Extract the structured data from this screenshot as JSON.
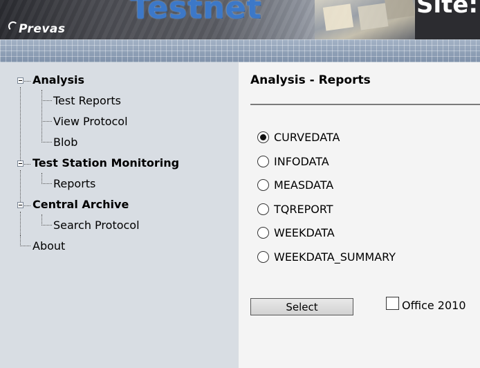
{
  "header": {
    "brand": "Prevas",
    "app_title": "Testnet",
    "site_label": "Site:"
  },
  "sidebar": {
    "groups": [
      {
        "label": "Analysis",
        "children": [
          "Test Reports",
          "View Protocol",
          "Blob"
        ]
      },
      {
        "label": "Test Station Monitoring",
        "children": [
          "Reports"
        ]
      },
      {
        "label": "Central Archive",
        "children": [
          "Search Protocol"
        ]
      }
    ],
    "about": "About"
  },
  "main": {
    "title": "Analysis - Reports",
    "options": [
      {
        "label": "CURVEDATA",
        "checked": true
      },
      {
        "label": "INFODATA",
        "checked": false
      },
      {
        "label": "MEASDATA",
        "checked": false
      },
      {
        "label": "TQREPORT",
        "checked": false
      },
      {
        "label": "WEEKDATA",
        "checked": false
      },
      {
        "label": "WEEKDATA_SUMMARY",
        "checked": false
      }
    ],
    "select_label": "Select",
    "office_label": "Office 2010",
    "office_checked": false
  }
}
